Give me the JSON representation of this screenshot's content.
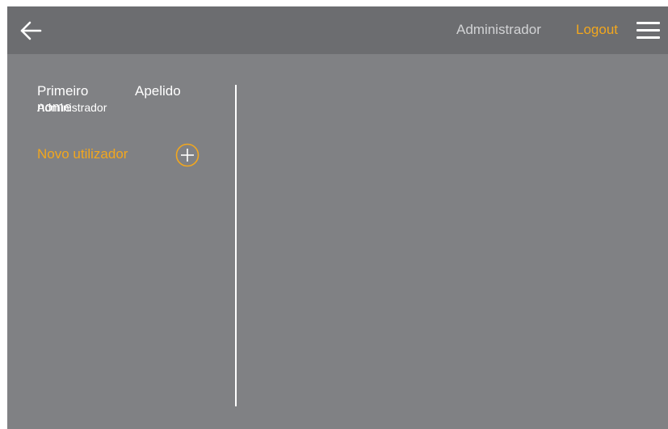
{
  "header": {
    "back_icon": "arrow-left-icon",
    "user_name": "Administrador",
    "logout_label": "Logout",
    "menu_icon": "hamburger-menu-icon"
  },
  "users_list": {
    "columns": {
      "first_name": "Primeiro nome",
      "last_name": "Apelido"
    },
    "rows": [
      {
        "first_name": "Administrador",
        "last_name": ""
      }
    ],
    "new_user_label": "Novo utilizador",
    "add_icon": "plus-circle-icon"
  },
  "colors": {
    "accent": "#f2a71e",
    "header_bg": "#6c6d70",
    "body_bg": "#808184",
    "text": "#ffffff",
    "muted_text": "#d2d3d5"
  }
}
